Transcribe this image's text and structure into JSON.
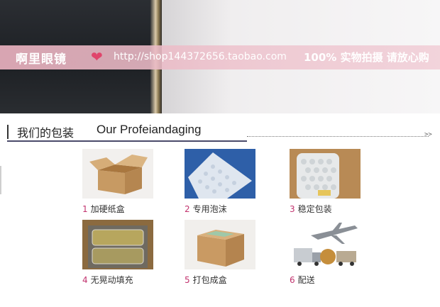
{
  "banner": {
    "shop_name": "啊里眼镜",
    "url": "http://shop144372656.taobao.com",
    "promo": "100% 实物拍摄 请放心购"
  },
  "section": {
    "title_cn": "我们的包装",
    "title_en": "Our Profeiandaging",
    "arrows": ">>"
  },
  "steps": [
    {
      "num": "1",
      "label": "加硬纸盒"
    },
    {
      "num": "2",
      "label": "专用泡沫"
    },
    {
      "num": "3",
      "label": "稳定包装"
    },
    {
      "num": "4",
      "label": "无晃动填充"
    },
    {
      "num": "5",
      "label": "打包成盒"
    },
    {
      "num": "6",
      "label": "配送"
    }
  ],
  "colors": {
    "accent_number": "#c2336e",
    "strip_pink": "#e8b0be",
    "heart": "#e0456b"
  },
  "icons": {
    "heart": "heart-icon",
    "arrows": "double-chevron-right-icon"
  }
}
